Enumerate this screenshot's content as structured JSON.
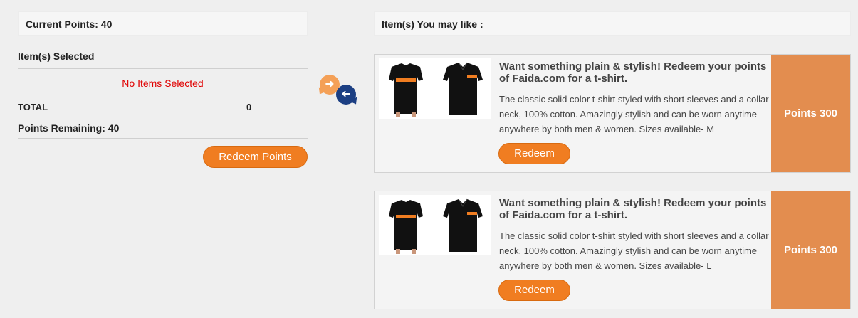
{
  "summary": {
    "current_points": "Current Points: 40",
    "items_selected_title": "Item(s) Selected",
    "no_items": "No Items Selected",
    "total_label": "TOTAL",
    "total_value": "0",
    "points_remaining": "Points Remaining: 40",
    "redeem_points_button": "Redeem Points"
  },
  "arrows": {
    "right_icon": "arrow-right-icon",
    "left_icon": "arrow-left-icon",
    "orange": "#f4a057",
    "blue": "#1c3f83"
  },
  "suggestions": {
    "header": "Item(s) You may like :",
    "items": [
      {
        "title": "Want something plain & stylish! Redeem your points of Faida.com for a t-shirt.",
        "description": "The classic solid color t-shirt styled with short sleeves and a collar neck, 100% cotton. Amazingly stylish and can be worn anytime anywhere by both men & women. Sizes available- M",
        "redeem_button": "Redeem",
        "points": "Points 300"
      },
      {
        "title": "Want something plain & stylish! Redeem your points of Faida.com for a t-shirt.",
        "description": "The classic solid color t-shirt styled with short sleeves and a collar neck, 100% cotton. Amazingly stylish and can be worn anytime anywhere by both men & women. Sizes available- L",
        "redeem_button": "Redeem",
        "points": "Points 300"
      }
    ]
  },
  "colors": {
    "accent": "#f07d21",
    "points_panel": "#e38d4f",
    "error": "#e00000"
  }
}
